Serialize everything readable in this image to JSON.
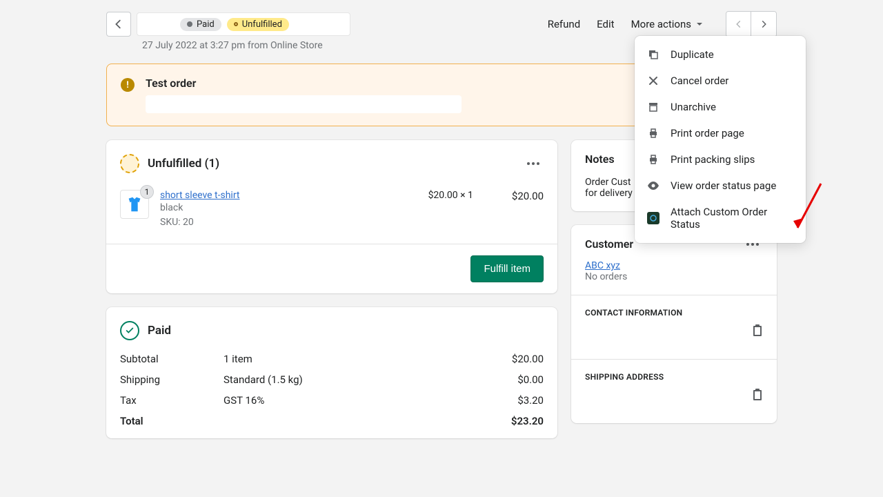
{
  "header": {
    "badges": {
      "paid": "Paid",
      "unfulfilled": "Unfulfilled"
    },
    "meta": "27 July 2022 at 3:27 pm from Online Store",
    "actions": {
      "refund": "Refund",
      "edit": "Edit",
      "more": "More actions"
    }
  },
  "banner": {
    "title": "Test order"
  },
  "fulfillment": {
    "title": "Unfulfilled (1)",
    "item": {
      "qty": "1",
      "title": "short sleeve t-shirt",
      "variant": "black",
      "sku": "SKU: 20",
      "unit": "$20.00 × 1",
      "total": "$20.00"
    },
    "fulfill_btn": "Fulfill item"
  },
  "payment": {
    "title": "Paid",
    "rows": {
      "subtotal": {
        "label": "Subtotal",
        "desc": "1 item",
        "val": "$20.00"
      },
      "shipping": {
        "label": "Shipping",
        "desc": "Standard (1.5 kg)",
        "val": "$0.00"
      },
      "tax": {
        "label": "Tax",
        "desc": "GST 16%",
        "val": "$3.20"
      },
      "total": {
        "label": "Total",
        "desc": "",
        "val": "$23.20"
      }
    }
  },
  "notes": {
    "title": "Notes",
    "body_prefix": "Order Cust",
    "body_line2": "for delivery"
  },
  "customer": {
    "title": "Customer",
    "name": "ABC xyz",
    "orders": "No orders",
    "contact_head": "CONTACT INFORMATION",
    "shipping_head": "SHIPPING ADDRESS"
  },
  "dropdown": {
    "duplicate": "Duplicate",
    "cancel": "Cancel order",
    "unarchive": "Unarchive",
    "print_order": "Print order page",
    "print_slips": "Print packing slips",
    "view_status": "View order status page",
    "attach_custom": "Attach Custom Order Status"
  }
}
